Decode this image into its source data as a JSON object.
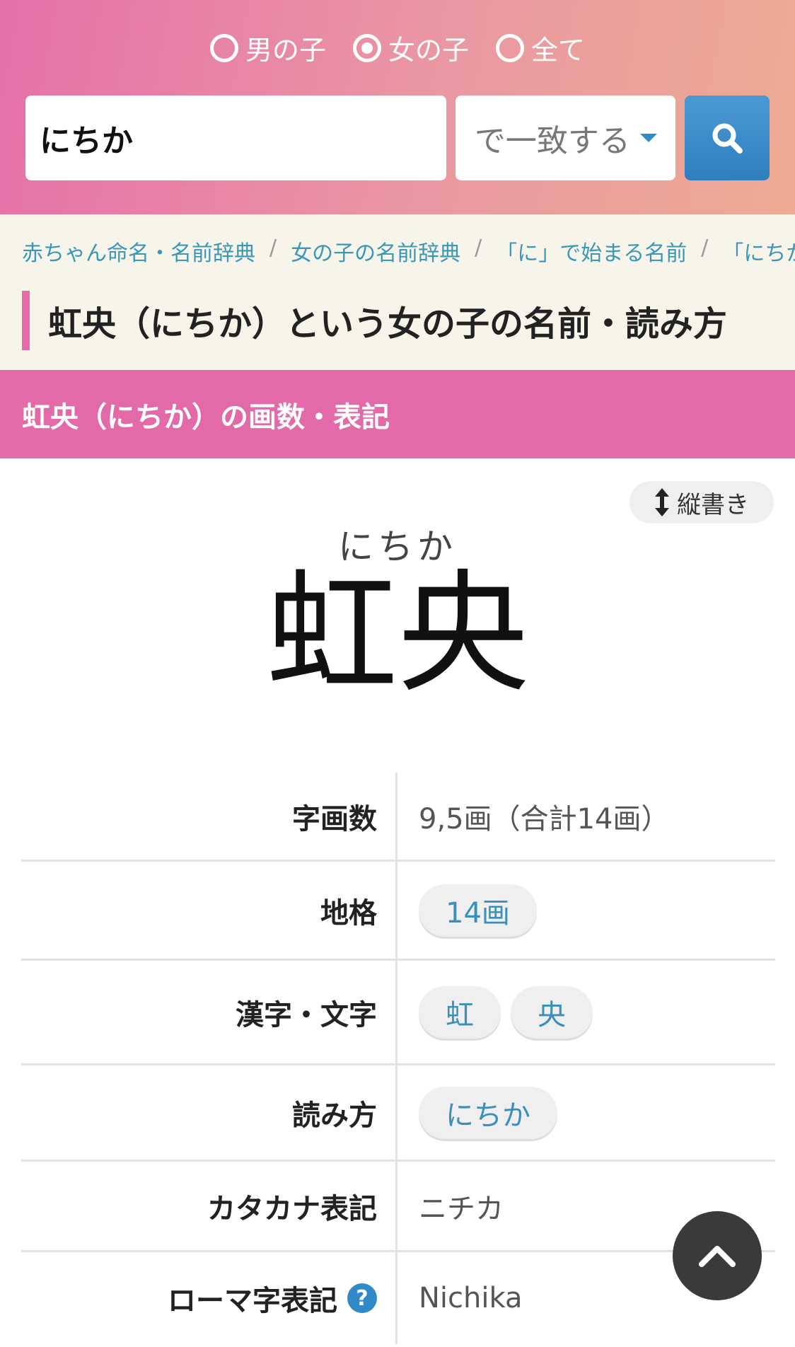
{
  "gender": {
    "options": [
      "男の子",
      "女の子",
      "全て"
    ],
    "selected": "女の子"
  },
  "search": {
    "query": "にちか",
    "match_mode": "で一致する"
  },
  "breadcrumb": [
    "赤ちゃん命名・名前辞典",
    "女の子の名前辞典",
    "「に」で始まる名前",
    "「にちか」"
  ],
  "page_title": "虹央（にちか）という女の子の名前・読み方",
  "section_title": "虹央（にちか）の画数・表記",
  "name": {
    "vertical_label": "縦書き",
    "furigana": "にちか",
    "kanji": "虹央"
  },
  "info": {
    "stroke_label": "字画数",
    "stroke_value": "9,5画（合計14画）",
    "chikaku_label": "地格",
    "chikaku_value": "14画",
    "kanji_label": "漢字・文字",
    "kanji_1": "虹",
    "kanji_2": "央",
    "reading_label": "読み方",
    "reading_value": "にちか",
    "katakana_label": "カタカナ表記",
    "katakana_value": "ニチカ",
    "roman_label": "ローマ字表記",
    "roman_value": "Nichika"
  },
  "colors": {
    "accent_pink": "#e26aa9",
    "link_blue": "#3b97b8",
    "search_button": "#2f7fbf"
  }
}
